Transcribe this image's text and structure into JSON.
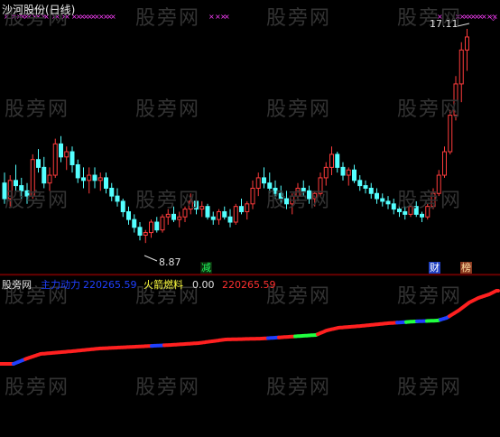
{
  "title": "沙河股份(日线)",
  "watermark": "股旁网",
  "price_high_label": "17.11",
  "price_low_label": "8.87",
  "badges": {
    "reduce": "减",
    "finance": "财",
    "ranking": "榜"
  },
  "indicator": {
    "source": "股旁网",
    "name1": "主力动力",
    "value1": "220265.59",
    "name2": "火箭燃料",
    "value2a": "0.00",
    "value2b": "220265.59"
  },
  "colors": {
    "up": "#ff3c3c",
    "down": "#54ffff",
    "marker": "#ff40ff",
    "line_red": "#ff2020",
    "line_blue": "#2040ff",
    "line_green": "#20ff40",
    "separator": "#a00000"
  },
  "chart_data": {
    "type": "candlestick",
    "price_labels": {
      "high": 17.11,
      "low": 8.87
    },
    "candles": [
      [
        11.2,
        11.6,
        10.4,
        10.6
      ],
      [
        10.6,
        11.5,
        10.3,
        11.3
      ],
      [
        11.3,
        11.9,
        10.9,
        11.1
      ],
      [
        11.1,
        11.4,
        10.6,
        10.9
      ],
      [
        10.9,
        11.2,
        10.4,
        10.7
      ],
      [
        10.7,
        12.3,
        10.6,
        12.1
      ],
      [
        12.1,
        12.5,
        11.6,
        11.8
      ],
      [
        11.8,
        12.2,
        11.0,
        11.2
      ],
      [
        11.2,
        11.8,
        10.9,
        11.5
      ],
      [
        11.5,
        12.9,
        11.4,
        12.7
      ],
      [
        12.7,
        13.0,
        12.0,
        12.2
      ],
      [
        12.2,
        12.6,
        11.7,
        12.4
      ],
      [
        12.4,
        12.6,
        11.6,
        11.9
      ],
      [
        11.9,
        12.1,
        11.2,
        11.4
      ],
      [
        11.4,
        11.8,
        11.0,
        11.3
      ],
      [
        11.3,
        11.8,
        10.8,
        11.5
      ],
      [
        11.5,
        11.8,
        11.0,
        11.3
      ],
      [
        11.3,
        11.6,
        10.9,
        11.4
      ],
      [
        11.4,
        11.6,
        10.8,
        11.0
      ],
      [
        11.0,
        11.2,
        10.5,
        10.7
      ],
      [
        10.7,
        11.0,
        10.3,
        10.5
      ],
      [
        10.5,
        10.6,
        9.9,
        10.1
      ],
      [
        10.1,
        10.3,
        9.6,
        9.8
      ],
      [
        9.8,
        10.0,
        9.3,
        9.5
      ],
      [
        9.5,
        9.7,
        9.0,
        9.2
      ],
      [
        9.2,
        9.4,
        8.9,
        9.3
      ],
      [
        9.3,
        9.8,
        9.1,
        9.7
      ],
      [
        9.7,
        9.9,
        9.3,
        9.4
      ],
      [
        9.4,
        10.0,
        9.3,
        9.9
      ],
      [
        9.9,
        10.2,
        9.6,
        10.0
      ],
      [
        10.0,
        10.3,
        9.7,
        9.8
      ],
      [
        9.8,
        10.1,
        9.5,
        9.9
      ],
      [
        9.9,
        10.3,
        9.7,
        10.2
      ],
      [
        10.2,
        10.8,
        10.0,
        10.5
      ],
      [
        10.5,
        10.6,
        10.0,
        10.2
      ],
      [
        10.2,
        10.5,
        9.9,
        10.3
      ],
      [
        10.3,
        10.4,
        9.8,
        9.9
      ],
      [
        9.9,
        10.1,
        9.6,
        9.8
      ],
      [
        9.8,
        10.2,
        9.6,
        10.1
      ],
      [
        10.1,
        10.3,
        9.8,
        9.9
      ],
      [
        9.9,
        10.2,
        9.5,
        9.7
      ],
      [
        9.7,
        10.4,
        9.6,
        10.3
      ],
      [
        10.3,
        10.6,
        10.0,
        10.1
      ],
      [
        10.1,
        10.5,
        9.8,
        10.4
      ],
      [
        10.4,
        11.3,
        10.2,
        11.0
      ],
      [
        11.0,
        11.6,
        10.7,
        11.4
      ],
      [
        11.4,
        11.8,
        11.0,
        11.2
      ],
      [
        11.2,
        11.6,
        10.8,
        11.0
      ],
      [
        11.0,
        11.3,
        10.6,
        10.8
      ],
      [
        10.8,
        11.1,
        10.4,
        10.6
      ],
      [
        10.6,
        10.9,
        10.2,
        10.4
      ],
      [
        10.4,
        10.8,
        10.0,
        10.7
      ],
      [
        10.7,
        11.2,
        10.5,
        11.0
      ],
      [
        11.0,
        11.3,
        10.7,
        10.9
      ],
      [
        10.9,
        11.1,
        10.4,
        10.6
      ],
      [
        10.6,
        10.9,
        10.3,
        10.8
      ],
      [
        10.8,
        11.6,
        10.7,
        11.4
      ],
      [
        11.4,
        12.0,
        11.1,
        11.8
      ],
      [
        11.8,
        12.6,
        11.5,
        12.3
      ],
      [
        12.3,
        12.4,
        11.6,
        11.8
      ],
      [
        11.8,
        12.0,
        11.3,
        11.5
      ],
      [
        11.5,
        11.8,
        11.1,
        11.7
      ],
      [
        11.7,
        11.9,
        11.2,
        11.3
      ],
      [
        11.3,
        11.5,
        10.9,
        11.1
      ],
      [
        11.1,
        11.3,
        10.8,
        11.0
      ],
      [
        11.0,
        11.2,
        10.6,
        10.8
      ],
      [
        10.8,
        11.0,
        10.4,
        10.6
      ],
      [
        10.6,
        10.8,
        10.3,
        10.5
      ],
      [
        10.5,
        10.7,
        10.2,
        10.4
      ],
      [
        10.4,
        10.6,
        10.0,
        10.2
      ],
      [
        10.2,
        10.4,
        9.9,
        10.1
      ],
      [
        10.1,
        10.3,
        9.8,
        10.0
      ],
      [
        10.0,
        10.4,
        9.9,
        10.3
      ],
      [
        10.3,
        10.5,
        9.9,
        10.0
      ],
      [
        10.0,
        10.1,
        9.7,
        9.9
      ],
      [
        9.9,
        10.4,
        9.8,
        10.3
      ],
      [
        10.3,
        11.0,
        10.2,
        10.8
      ],
      [
        10.8,
        11.7,
        10.7,
        11.5
      ],
      [
        11.5,
        12.6,
        11.4,
        12.4
      ],
      [
        12.4,
        14.0,
        12.3,
        13.8
      ],
      [
        13.8,
        15.3,
        13.6,
        15.0
      ],
      [
        15.0,
        16.6,
        14.3,
        16.3
      ],
      [
        16.3,
        17.11,
        15.5,
        16.8
      ]
    ]
  }
}
